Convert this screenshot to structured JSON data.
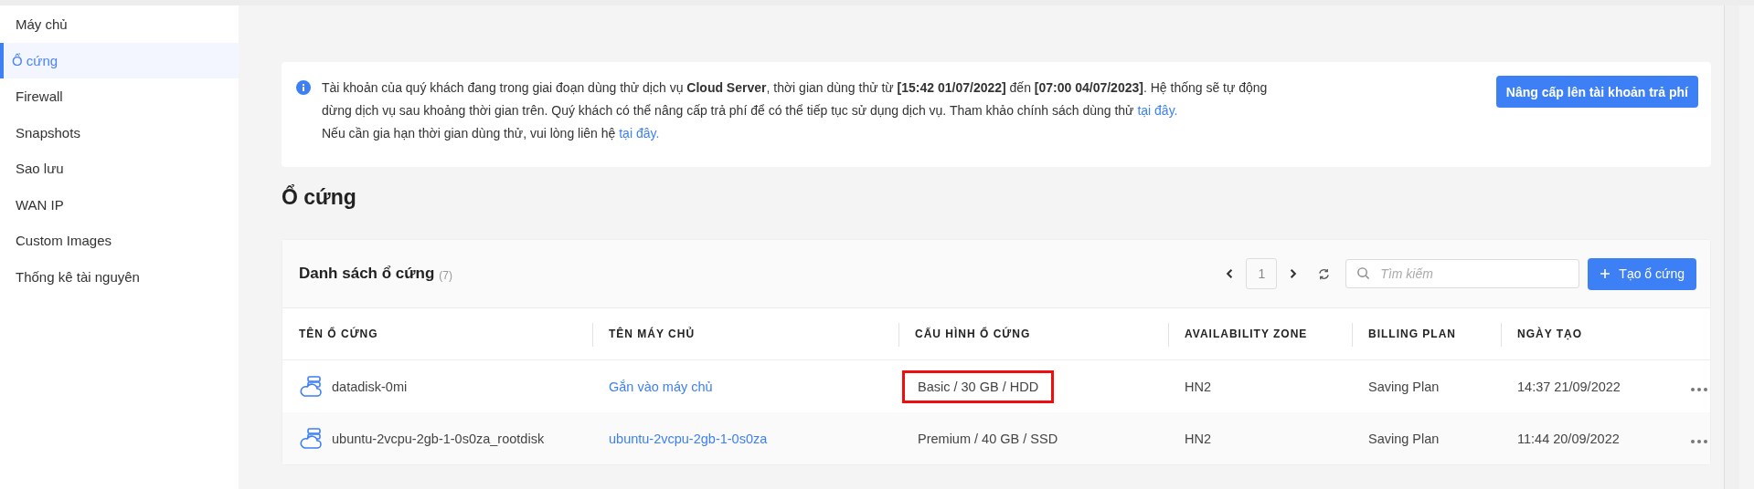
{
  "sidebar": {
    "items": [
      {
        "label": "Máy chủ",
        "selected": false
      },
      {
        "label": "Ổ cứng",
        "selected": true
      },
      {
        "label": "Firewall",
        "selected": false
      },
      {
        "label": "Snapshots",
        "selected": false
      },
      {
        "label": "Sao lưu",
        "selected": false
      },
      {
        "label": "WAN IP",
        "selected": false
      },
      {
        "label": "Custom Images",
        "selected": false
      },
      {
        "label": "Thống kê tài nguyên",
        "selected": false
      }
    ]
  },
  "notice": {
    "lines": [
      {
        "text": "Tài khoản của quý khách đang trong giai đoạn dùng thử dịch vụ **Cloud Server**, thời gian dùng thử từ **[15:42 01/07/2022]** đến **[07:00 04/07/2023]**. Hệ thống sẽ tự động dừng dịch vụ sau khoảng thời gian trên. Quý khách có thể nâng cấp trả phí để có thể tiếp tục sử dụng dịch vụ. Tham khảo chính sách dùng thử",
        "link": "tại đây."
      },
      {
        "text": "Nếu cần gia hạn thời gian dùng thử, vui lòng liên hệ",
        "link": "tại đây."
      }
    ],
    "button": "Nâng cấp lên tài khoản trả phí"
  },
  "page_title": "Ổ cứng",
  "card": {
    "title": "Danh sách ổ cứng",
    "count": "(7)",
    "page": "1",
    "search": {
      "placeholder": "Tìm kiếm"
    },
    "create_button": "Tạo ổ cứng"
  },
  "table": {
    "columns": [
      "TÊN Ổ CỨNG",
      "TÊN MÁY CHỦ",
      "CẤU HÌNH Ổ CỨNG",
      "AVAILABILITY ZONE",
      "BILLING PLAN",
      "NGÀY TẠO"
    ],
    "rows": [
      {
        "name": "datadisk-0mi",
        "server": "Gắn vào máy chủ",
        "config": "Basic / 30 GB / HDD",
        "highlighted": true,
        "zone": "HN2",
        "plan": "Saving Plan",
        "created": "14:37 21/09/2022"
      },
      {
        "name": "ubuntu-2vcpu-2gb-1-0s0za_rootdisk",
        "server": "ubuntu-2vcpu-2gb-1-0s0za",
        "config": "Premium / 40 GB / SSD",
        "highlighted": false,
        "zone": "HN2",
        "plan": "Saving Plan",
        "created": "11:44 20/09/2022"
      }
    ]
  }
}
